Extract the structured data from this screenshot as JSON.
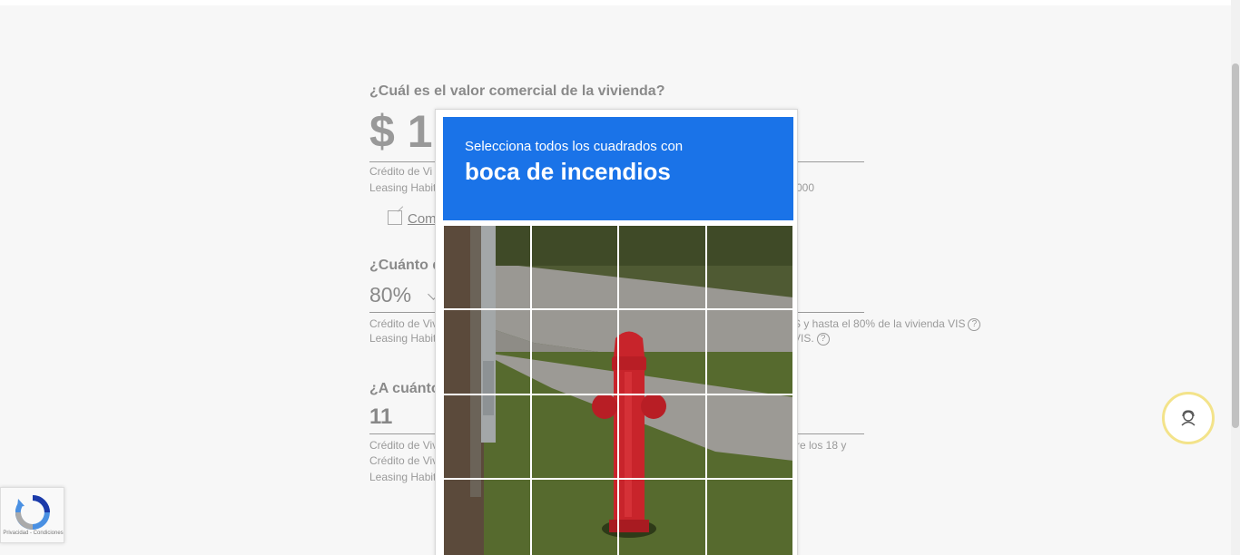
{
  "form": {
    "q1": {
      "label": "¿Cuál es el valor comercial de la vivienda?",
      "value": "$ 1",
      "note1": "Crédito de Vi",
      "note2": "Leasing Habit",
      "note2_suffix": "000",
      "link": "Com"
    },
    "q2": {
      "label": "¿Cuánto d",
      "value": "80%",
      "note1": "Crédito de Viv",
      "note1_suffix": "S y hasta el 80% de la vivienda VIS",
      "note2": "Leasing Habit",
      "note2_suffix": "VIS.",
      "help": "?"
    },
    "q3": {
      "label": "¿A cuánto",
      "value": "11",
      "note1": "Crédito de Viv",
      "note1_suffix": "re los 18 y",
      "note2": "Crédito de Viv",
      "note3": "Leasing Habit"
    }
  },
  "captcha": {
    "instruction": "Selecciona todos los cuadrados con",
    "target": "boca de incendios",
    "grid_rows": 4,
    "grid_cols": 4
  },
  "recaptcha_badge": {
    "legal": "Privacidad - Condiciones",
    "icon": "recaptcha-logo-icon"
  },
  "chat_button": {
    "icon": "support-agent-icon"
  },
  "colors": {
    "captcha_blue": "#1a73e8",
    "hydrant_red": "#c8242b",
    "chat_ring": "#f3e38a"
  }
}
